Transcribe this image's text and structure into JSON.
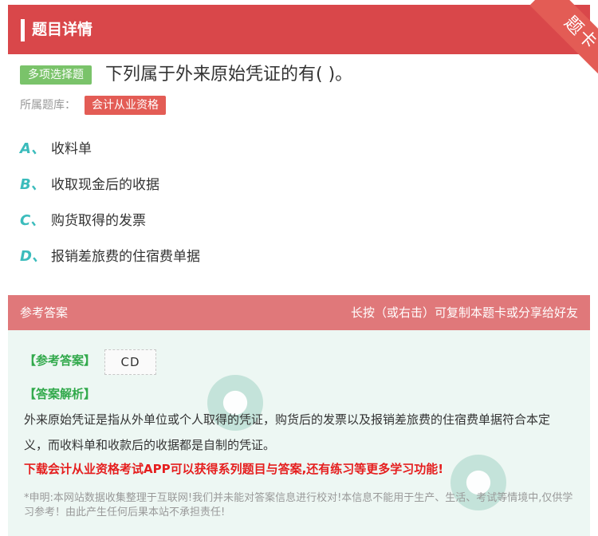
{
  "header": {
    "title": "题目详情",
    "ribbon_label": "题卡"
  },
  "question": {
    "type_label": "多项选择题",
    "text": "下列属于外来原始凭证的有( )。",
    "bank_label": "所属题库：",
    "bank_name": "会计从业资格"
  },
  "options": [
    {
      "letter": "A",
      "sep": "、",
      "text": "收料单"
    },
    {
      "letter": "B",
      "sep": "、",
      "text": "收取现金后的收据"
    },
    {
      "letter": "C",
      "sep": "、",
      "text": "购货取得的发票"
    },
    {
      "letter": "D",
      "sep": "、",
      "text": "报销差旅费的住宿费单据"
    }
  ],
  "answer": {
    "head_left": "参考答案",
    "head_right": "长按（或右击）可复制本题卡或分享给好友",
    "ref_label": "【参考答案】",
    "ref_value": "CD",
    "analysis_label": "【答案解析】",
    "analysis_text": "外来原始凭证是指从外单位或个人取得的凭证，购货后的发票以及报销差旅费的住宿费单据符合本定义，而收料单和收款后的收据都是自制的凭证。",
    "promo": "下载会计从业资格考试APP可以获得系列题目与答案,还有练习等更多学习功能!",
    "disclaimer": "*申明:本网站数据收集整理于互联网!我们并未能对答案信息进行校对!本信息不能用于生产、生活、考试等情境中,仅供学习参考！由此产生任何后果本站不承担责任!"
  },
  "colors": {
    "header": "#d9474a",
    "answer_head": "#e0787a",
    "type_tag": "#7ac36a",
    "bank_tag": "#e35c55",
    "option_letter": "#3bbcbc",
    "promo": "#e51e1e"
  }
}
